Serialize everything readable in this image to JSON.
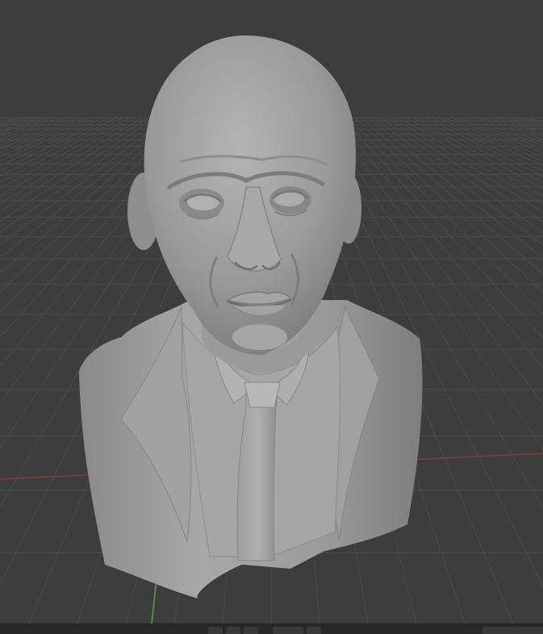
{
  "app": {
    "name": "3D Viewport",
    "view_mode": "perspective",
    "shading": "solid"
  },
  "viewport": {
    "background_color": "#3d3d3d",
    "grid_color": "#4a4a4a",
    "x_axis_color": "#8b3a3a",
    "y_axis_color": "#6a9a3a",
    "object_color": "#9a9a9a",
    "object_name": "bust-sculpt-mesh"
  },
  "statusbar": {
    "chips": [
      "",
      "",
      "",
      "",
      "",
      ""
    ]
  }
}
